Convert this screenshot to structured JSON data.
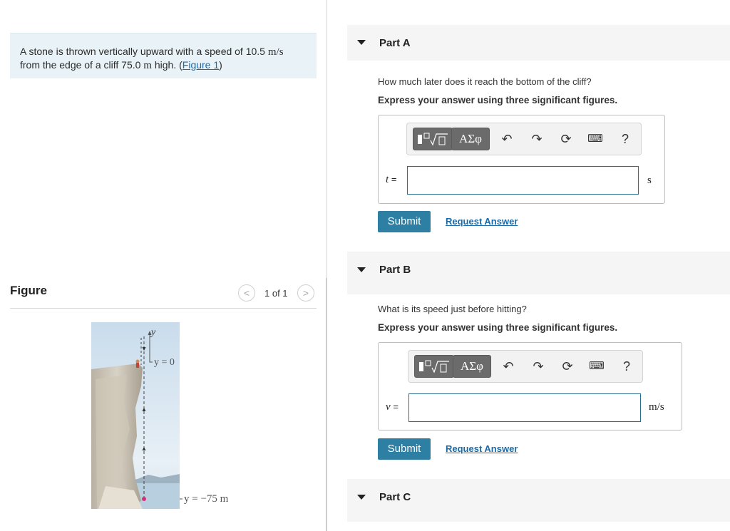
{
  "problem": {
    "text_before_speed": "A stone is thrown vertically upward with a speed of 10.5 ",
    "speed_unit": "m/s",
    "text_from": "from the edge of a cliff 75.0 ",
    "height_unit": "m",
    "text_high": " high. (",
    "figure_link": "Figure 1",
    "text_close": ")"
  },
  "figure": {
    "title": "Figure",
    "pager_prev": "<",
    "pager_text": "1 of 1",
    "pager_next": ">",
    "y_axis_label": "y",
    "y_zero_label": "y = 0",
    "y_bottom_label": "y = −75 m"
  },
  "toolbar": {
    "greek_label": "ΑΣφ",
    "undo_icon": "undo-icon",
    "redo_icon": "redo-icon",
    "reset_icon": "reset-icon",
    "keyboard_icon": "keyboard-icon",
    "help_label": "?"
  },
  "parts": [
    {
      "title": "Part A",
      "question": "How much later does it reach the bottom of the cliff?",
      "instruction": "Express your answer using three significant figures.",
      "variable": "t",
      "equals": "=",
      "unit": "s",
      "input_value": "",
      "submit_label": "Submit",
      "request_label": "Request Answer"
    },
    {
      "title": "Part B",
      "question": "What is its speed just before hitting?",
      "instruction": "Express your answer using three significant figures.",
      "variable": "v",
      "equals": "=",
      "unit": "m/s",
      "input_value": "",
      "submit_label": "Submit",
      "request_label": "Request Answer"
    },
    {
      "title": "Part C"
    }
  ],
  "colors": {
    "accent": "#2d7fa3",
    "link": "#1a6aa8",
    "problem_bg": "#e9f3f7"
  }
}
